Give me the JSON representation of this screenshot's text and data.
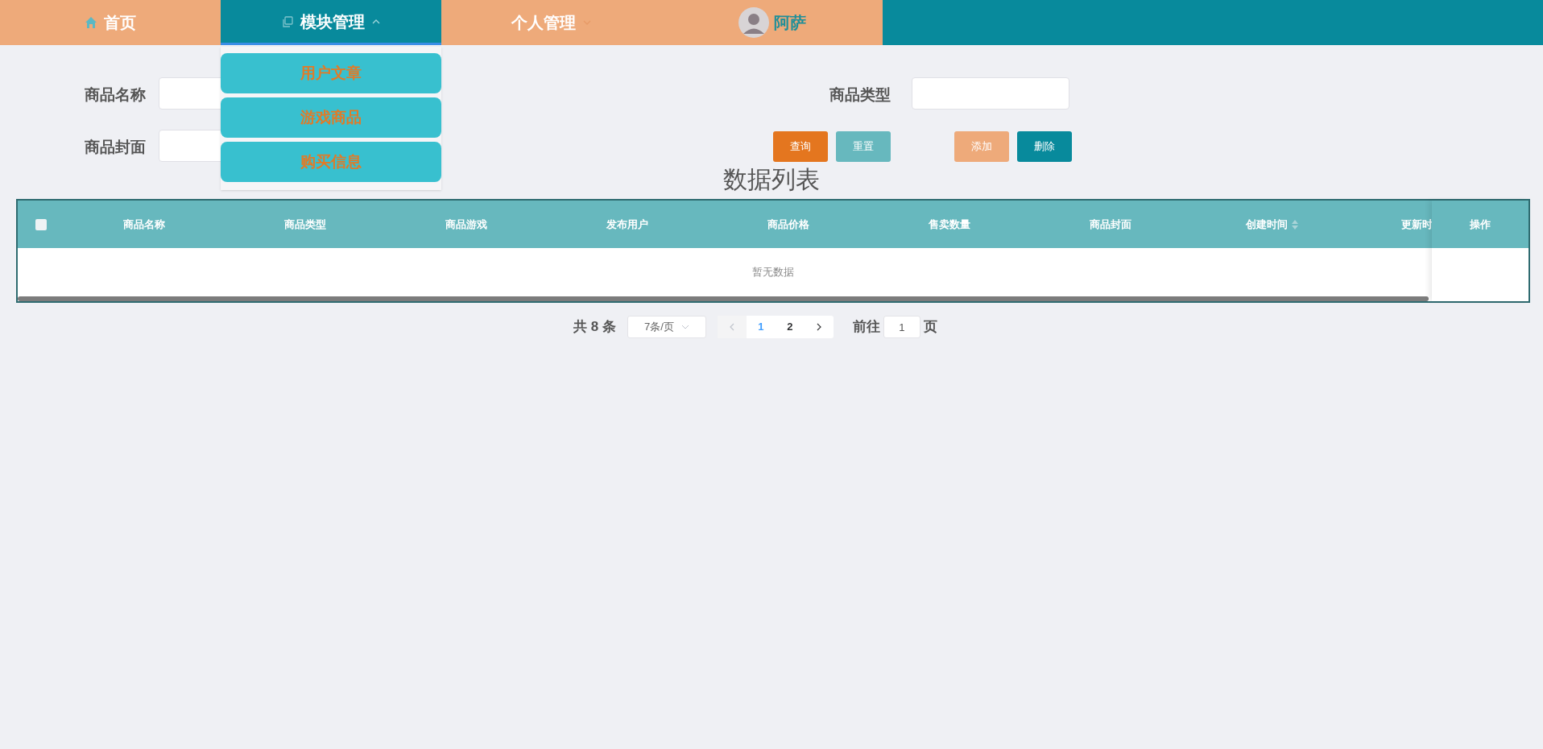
{
  "nav": {
    "items": [
      {
        "label": "首页",
        "kind": "link",
        "selected": false
      },
      {
        "label": "模块管理",
        "kind": "menu",
        "expanded": true,
        "selected": true
      },
      {
        "label": "个人管理",
        "kind": "menu",
        "expanded": false,
        "selected": false
      }
    ],
    "user": {
      "name": "阿萨"
    }
  },
  "dropdown": {
    "items": [
      {
        "label": "用户文章"
      },
      {
        "label": "游戏商品"
      },
      {
        "label": "购买信息"
      }
    ]
  },
  "form": {
    "fields": [
      {
        "label": "商品名称"
      },
      {
        "label": "商品类型"
      },
      {
        "label": "商品封面"
      }
    ],
    "buttons": [
      {
        "label": "查询",
        "kind": "search"
      },
      {
        "label": "重置",
        "kind": "reset"
      },
      {
        "label": "添加",
        "kind": "add"
      },
      {
        "label": "删除",
        "kind": "delete"
      }
    ]
  },
  "title": "数据列表",
  "table": {
    "select_all": false,
    "columns": [
      {
        "label": "商品名称",
        "sortable": false
      },
      {
        "label": "商品类型",
        "sortable": false
      },
      {
        "label": "商品游戏",
        "sortable": false
      },
      {
        "label": "发布用户",
        "sortable": false
      },
      {
        "label": "商品价格",
        "sortable": false
      },
      {
        "label": "售卖数量",
        "sortable": false
      },
      {
        "label": "商品封面",
        "sortable": false
      },
      {
        "label": "创建时间",
        "sortable": true
      },
      {
        "label": "更新时",
        "sortable": false
      }
    ],
    "fixed_column": "操作",
    "empty_text": "暂无数据"
  },
  "pagination": {
    "total": "共 8 条",
    "page_size": "7条/页",
    "pages": [
      {
        "label": "1",
        "selected": true
      },
      {
        "label": "2",
        "selected": false
      }
    ],
    "goto_label": "前往",
    "goto_value": "1",
    "page_suffix": "页"
  }
}
